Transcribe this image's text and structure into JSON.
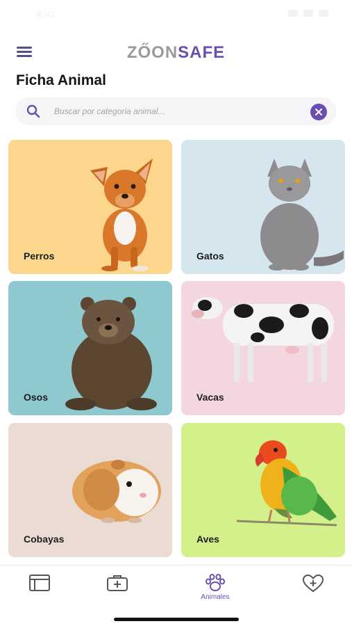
{
  "status_bar": {
    "time": "9:41"
  },
  "header": {
    "logo_part1": "ZŐON",
    "logo_part2": "SAFE",
    "menu_icon": "hamburger-menu-icon"
  },
  "page": {
    "title": "Ficha Animal"
  },
  "search": {
    "placeholder": "Buscar por categoria animal...",
    "value": "",
    "search_icon": "search-icon",
    "clear_icon": "close-icon"
  },
  "categories": [
    {
      "label": "Perros",
      "bg": "#fdd68d"
    },
    {
      "label": "Gatos",
      "bg": "#d6e6ef"
    },
    {
      "label": "Osos",
      "bg": "#8dc9cf"
    },
    {
      "label": "Vacas",
      "bg": "#f3d6de"
    },
    {
      "label": "Cobayas",
      "bg": "#ebdcd3"
    },
    {
      "label": "Aves",
      "bg": "#d3f08b"
    }
  ],
  "tabbar": {
    "tabs": [
      {
        "icon": "browser-window-icon",
        "label": ""
      },
      {
        "icon": "medical-kit-icon",
        "label": ""
      },
      {
        "icon": "paw-icon",
        "label": "Animales",
        "active": true
      },
      {
        "icon": "heart-plus-icon",
        "label": ""
      }
    ]
  },
  "colors": {
    "accent": "#6a4fb0",
    "icon_gray": "#555555"
  }
}
